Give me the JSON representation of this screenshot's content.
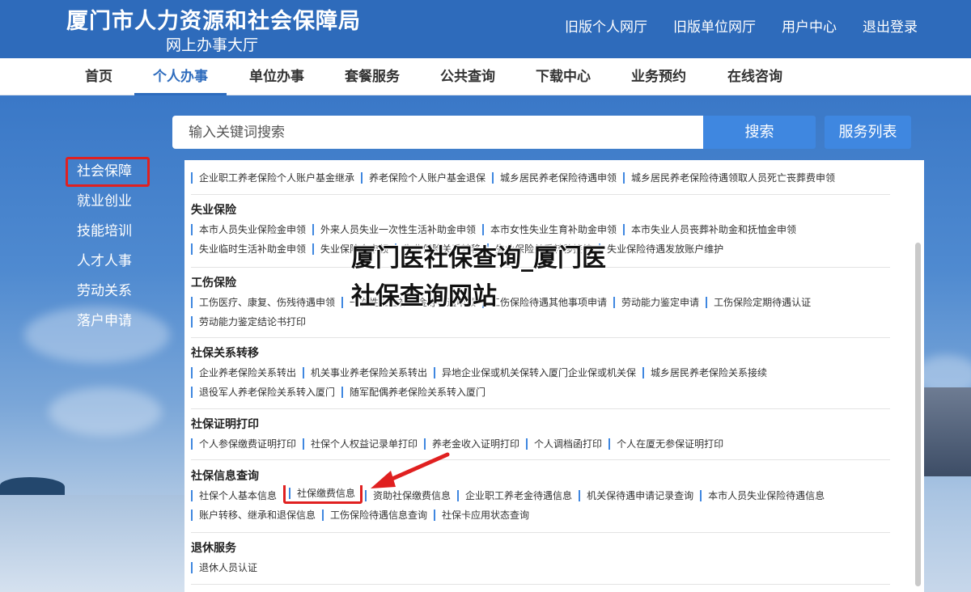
{
  "header": {
    "title": "厦门市人力资源和社会保障局",
    "subtitle": "网上办事大厅",
    "links": [
      "旧版个人网厅",
      "旧版单位网厅",
      "用户中心",
      "退出登录"
    ]
  },
  "nav": {
    "items": [
      "首页",
      "个人办事",
      "单位办事",
      "套餐服务",
      "公共查询",
      "下载中心",
      "业务预约",
      "在线咨询"
    ],
    "active": "个人办事"
  },
  "search": {
    "placeholder": "输入关键词搜索",
    "button_label": "搜索",
    "service_list_label": "服务列表"
  },
  "side_menu": {
    "items": [
      "社会保障",
      "就业创业",
      "技能培训",
      "人才人事",
      "劳动关系",
      "落户申请"
    ],
    "active": "社会保障"
  },
  "content": {
    "top_partial_row": [
      "企业职工养老保险个人账户基金继承",
      "养老保险个人账户基金退保",
      "城乡居民养老保险待遇申领",
      "城乡居民养老保险待遇领取人员死亡丧葬费申领"
    ],
    "sections": [
      {
        "title": "失业保险",
        "rows": [
          [
            "本市人员失业保险金申领",
            "外来人员失业一次性生活补助金申领",
            "本市女性失业生育补助金申领",
            "本市失业人员丧葬补助金和抚恤金申领"
          ],
          [
            "失业临时生活补助金申领",
            "失业保险金申领",
            "失业保险关系转移",
            "失业保险关系转移接续",
            "失业保险待遇发放账户维护"
          ]
        ]
      },
      {
        "title": "工伤保险",
        "rows": [
          [
            "工伤医疗、康复、伤残待遇申领",
            "一次性工亡补助金等待遇申领",
            "工伤保险待遇其他事项申请",
            "劳动能力鉴定申请",
            "工伤保险定期待遇认证"
          ],
          [
            "劳动能力鉴定结论书打印"
          ]
        ]
      },
      {
        "title": "社保关系转移",
        "rows": [
          [
            "企业养老保险关系转出",
            "机关事业养老保险关系转出",
            "异地企业保或机关保转入厦门企业保或机关保",
            "城乡居民养老保险关系接续"
          ],
          [
            "退役军人养老保险关系转入厦门",
            "随军配偶养老保险关系转入厦门"
          ]
        ]
      },
      {
        "title": "社保证明打印",
        "rows": [
          [
            "个人参保缴费证明打印",
            "社保个人权益记录单打印",
            "养老金收入证明打印",
            "个人调档函打印",
            "个人在厦无参保证明打印"
          ]
        ]
      },
      {
        "title": "社保信息查询",
        "rows": [
          [
            "社保个人基本信息",
            "社保缴费信息",
            "资助社保缴费信息",
            "企业职工养老金待遇信息",
            "机关保待遇申请记录查询",
            "本市人员失业保险待遇信息"
          ],
          [
            "账户转移、继承和退保信息",
            "工伤保险待遇信息查询",
            "社保卡应用状态查询"
          ]
        ],
        "highlighted": "社保缴费信息"
      },
      {
        "title": "退休服务",
        "rows": [
          [
            "退休人员认证"
          ]
        ]
      }
    ]
  },
  "overlay_text": "厦门医社保查询_厦门医社保查询网站",
  "colors": {
    "header_bg": "#2e6bbb",
    "accent": "#3f87e0",
    "highlight_red": "#e02020"
  }
}
